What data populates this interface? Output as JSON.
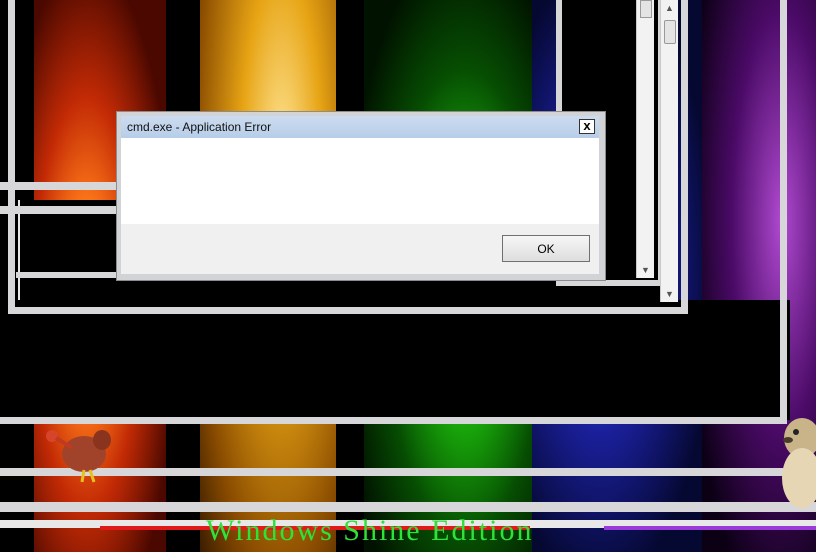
{
  "dialog": {
    "title": "cmd.exe - Application Error",
    "close_glyph": "x",
    "ok_label": "OK"
  },
  "desktop": {
    "theme_text": "Windows Shine Edition"
  },
  "icons": {
    "close": "close-icon",
    "scroll_up": "scroll-up-arrow-icon",
    "scroll_down": "scroll-down-arrow-icon",
    "bird": "bird-mascot-icon",
    "hamster": "hamster-mascot-icon"
  },
  "colors": {
    "titlebar": "#b7cde8",
    "frame": "#d7d7d9",
    "theme_text": "#2ee23a"
  }
}
